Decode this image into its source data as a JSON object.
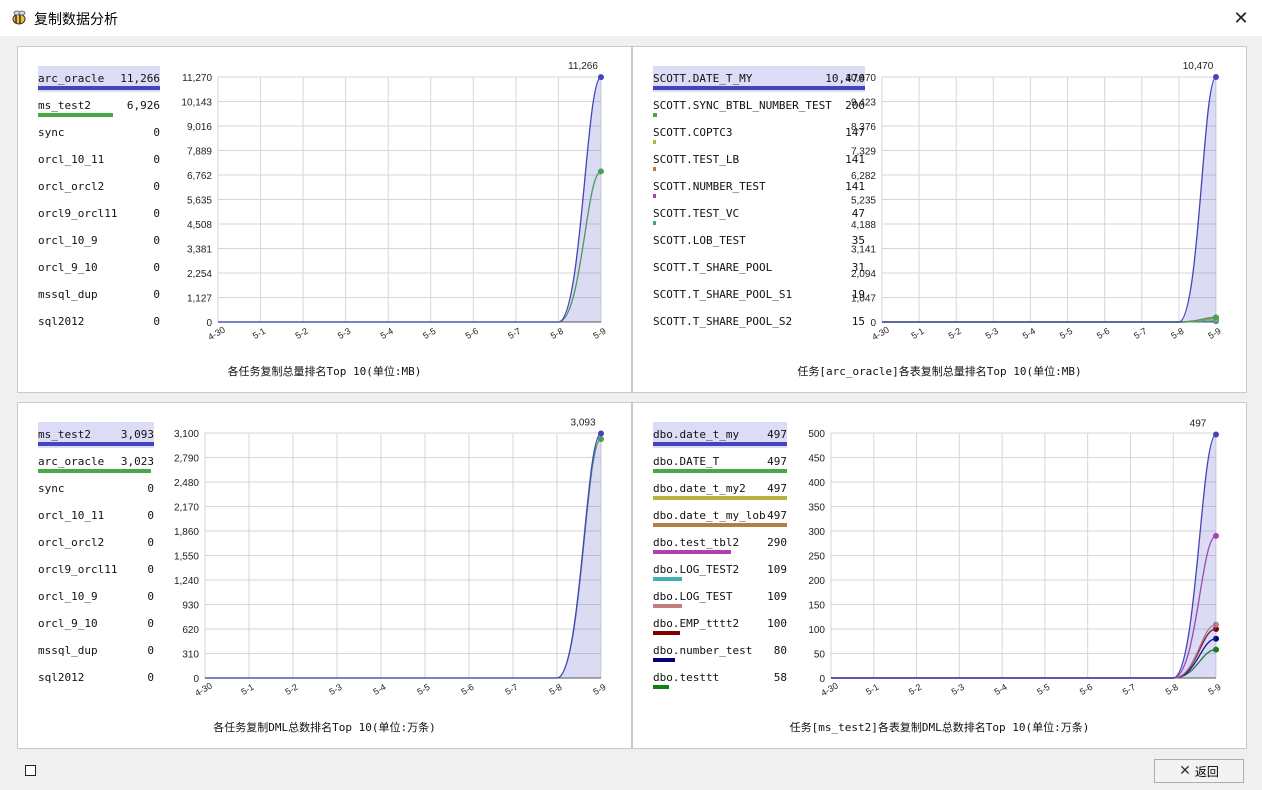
{
  "window": {
    "title": "复制数据分析",
    "close_icon": "close-icon"
  },
  "footer": {
    "back_label": "返回"
  },
  "panels": [
    {
      "caption": "各任务复制总量排名Top 10(单位:MB)",
      "legend": [
        {
          "name": "arc_oracle",
          "value": "11,266",
          "color": "#4444bb",
          "selected": true
        },
        {
          "name": "ms_test2",
          "value": "6,926",
          "color": "#44aa44"
        },
        {
          "name": "sync",
          "value": "0"
        },
        {
          "name": "orcl_10_11",
          "value": "0"
        },
        {
          "name": "orcl_orcl2",
          "value": "0"
        },
        {
          "name": "orcl9_orcl11",
          "value": "0"
        },
        {
          "name": "orcl_10_9",
          "value": "0"
        },
        {
          "name": "orcl_9_10",
          "value": "0"
        },
        {
          "name": "mssql_dup",
          "value": "0"
        },
        {
          "name": "sql2012",
          "value": "0"
        }
      ],
      "chart_data": {
        "type": "area",
        "x": [
          "4-30",
          "5-1",
          "5-2",
          "5-3",
          "5-4",
          "5-5",
          "5-6",
          "5-7",
          "5-8",
          "5-9"
        ],
        "y_ticks": [
          "0",
          "1,127",
          "2,254",
          "3,381",
          "4,508",
          "5,635",
          "6,762",
          "7,889",
          "9,016",
          "10,143",
          "11,270"
        ],
        "ylim": [
          0,
          11270
        ],
        "peak_label": "11,266",
        "series": [
          {
            "name": "arc_oracle",
            "color": "#4444bb",
            "values": [
              0,
              0,
              0,
              0,
              0,
              0,
              0,
              0,
              0,
              11266
            ],
            "fill": true
          },
          {
            "name": "ms_test2",
            "color": "#44aa44",
            "values": [
              0,
              0,
              0,
              0,
              0,
              0,
              0,
              0,
              0,
              6926
            ]
          }
        ]
      }
    },
    {
      "caption": "任务[arc_oracle]各表复制总量排名Top 10(单位:MB)",
      "legend": [
        {
          "name": "SCOTT.DATE_T_MY",
          "value": "10,470",
          "color": "#4444bb",
          "selected": true
        },
        {
          "name": "SCOTT.SYNC_BTBL_NUMBER_TEST",
          "value": "200",
          "color": "#44aa44"
        },
        {
          "name": "SCOTT.COPTC3",
          "value": "147",
          "color": "#b8b040"
        },
        {
          "name": "SCOTT.TEST_LB",
          "value": "141",
          "color": "#b08040"
        },
        {
          "name": "SCOTT.NUMBER_TEST",
          "value": "141",
          "color": "#b040b0"
        },
        {
          "name": "SCOTT.TEST_VC",
          "value": "47",
          "color": "#40a0a0"
        },
        {
          "name": "SCOTT.LOB_TEST",
          "value": "35"
        },
        {
          "name": "SCOTT.T_SHARE_POOL",
          "value": "31"
        },
        {
          "name": "SCOTT.T_SHARE_POOL_S1",
          "value": "19"
        },
        {
          "name": "SCOTT.T_SHARE_POOL_S2",
          "value": "15"
        }
      ],
      "chart_data": {
        "type": "area",
        "x": [
          "4-30",
          "5-1",
          "5-2",
          "5-3",
          "5-4",
          "5-5",
          "5-6",
          "5-7",
          "5-8",
          "5-9"
        ],
        "y_ticks": [
          "0",
          "1,047",
          "2,094",
          "3,141",
          "4,188",
          "5,235",
          "6,282",
          "7,329",
          "8,376",
          "9,423",
          "10,470"
        ],
        "ylim": [
          0,
          10470
        ],
        "peak_label": "10,470",
        "series": [
          {
            "name": "SCOTT.DATE_T_MY",
            "color": "#4444bb",
            "values": [
              0,
              0,
              0,
              0,
              0,
              0,
              0,
              0,
              0,
              10470
            ],
            "fill": true
          },
          {
            "name": "SCOTT.SYNC_BTBL_NUMBER_TEST",
            "color": "#44aa44",
            "values": [
              0,
              0,
              0,
              0,
              0,
              0,
              0,
              0,
              0,
              200
            ]
          },
          {
            "name": "SCOTT.COPTC3",
            "color": "#b8b040",
            "values": [
              0,
              0,
              0,
              0,
              0,
              0,
              0,
              0,
              0,
              147
            ]
          },
          {
            "name": "SCOTT.TEST_LB",
            "color": "#b08040",
            "values": [
              0,
              0,
              0,
              0,
              0,
              0,
              0,
              0,
              0,
              141
            ]
          },
          {
            "name": "SCOTT.NUMBER_TEST",
            "color": "#b040b0",
            "values": [
              0,
              0,
              0,
              0,
              0,
              0,
              0,
              0,
              0,
              141
            ]
          },
          {
            "name": "SCOTT.TEST_VC",
            "color": "#40a0a0",
            "values": [
              0,
              0,
              0,
              0,
              0,
              0,
              0,
              0,
              0,
              47
            ]
          },
          {
            "name": "SCOTT.LOB_TEST",
            "color": "#108010",
            "values": [
              0,
              0,
              0,
              0,
              0,
              0,
              0,
              0,
              0,
              35
            ]
          }
        ]
      }
    },
    {
      "caption": "各任务复制DML总数排名Top 10(单位:万条)",
      "legend": [
        {
          "name": "ms_test2",
          "value": "3,093",
          "color": "#4444bb",
          "selected": true
        },
        {
          "name": "arc_oracle",
          "value": "3,023",
          "color": "#44aa44"
        },
        {
          "name": "sync",
          "value": "0"
        },
        {
          "name": "orcl_10_11",
          "value": "0"
        },
        {
          "name": "orcl_orcl2",
          "value": "0"
        },
        {
          "name": "orcl9_orcl11",
          "value": "0"
        },
        {
          "name": "orcl_10_9",
          "value": "0"
        },
        {
          "name": "orcl_9_10",
          "value": "0"
        },
        {
          "name": "mssql_dup",
          "value": "0"
        },
        {
          "name": "sql2012",
          "value": "0"
        }
      ],
      "chart_data": {
        "type": "area",
        "x": [
          "4-30",
          "5-1",
          "5-2",
          "5-3",
          "5-4",
          "5-5",
          "5-6",
          "5-7",
          "5-8",
          "5-9"
        ],
        "y_ticks": [
          "0",
          "310",
          "620",
          "930",
          "1,240",
          "1,550",
          "1,860",
          "2,170",
          "2,480",
          "2,790",
          "3,100"
        ],
        "ylim": [
          0,
          3100
        ],
        "peak_label": "3,093",
        "series": [
          {
            "name": "ms_test2",
            "color": "#4444bb",
            "values": [
              0,
              0,
              0,
              0,
              0,
              0,
              0,
              0,
              0,
              3093
            ],
            "fill": true
          },
          {
            "name": "arc_oracle",
            "color": "#44aa44",
            "values": [
              0,
              0,
              0,
              0,
              0,
              0,
              0,
              0,
              0,
              3023
            ]
          }
        ]
      }
    },
    {
      "caption": "任务[ms_test2]各表复制DML总数排名Top 10(单位:万条)",
      "legend": [
        {
          "name": "dbo.date_t_my",
          "value": "497",
          "color": "#4444bb",
          "selected": true
        },
        {
          "name": "dbo.DATE_T",
          "value": "497",
          "color": "#44aa44"
        },
        {
          "name": "dbo.date_t_my2",
          "value": "497",
          "color": "#b8b040"
        },
        {
          "name": "dbo.date_t_my_lob",
          "value": "497",
          "color": "#b08040"
        },
        {
          "name": "dbo.test_tbl2",
          "value": "290",
          "color": "#b040b0"
        },
        {
          "name": "dbo.LOG_TEST2",
          "value": "109",
          "color": "#40b0b0"
        },
        {
          "name": "dbo.LOG_TEST",
          "value": "109",
          "color": "#c08080"
        },
        {
          "name": "dbo.EMP_tttt2",
          "value": "100",
          "color": "#800000"
        },
        {
          "name": "dbo.number_test",
          "value": "80",
          "color": "#000080"
        },
        {
          "name": "dbo.testtt",
          "value": "58",
          "color": "#108010"
        }
      ],
      "chart_data": {
        "type": "area",
        "x": [
          "4-30",
          "5-1",
          "5-2",
          "5-3",
          "5-4",
          "5-5",
          "5-6",
          "5-7",
          "5-8",
          "5-9"
        ],
        "y_ticks": [
          "0",
          "50",
          "100",
          "150",
          "200",
          "250",
          "300",
          "350",
          "400",
          "450",
          "500"
        ],
        "ylim": [
          0,
          500
        ],
        "peak_label": "497",
        "series": [
          {
            "name": "dbo.date_t_my",
            "color": "#4444bb",
            "values": [
              0,
              0,
              0,
              0,
              0,
              0,
              0,
              0,
              0,
              497
            ],
            "fill": true
          },
          {
            "name": "dbo.test_tbl2",
            "color": "#b040b0",
            "values": [
              0,
              0,
              0,
              0,
              0,
              0,
              0,
              0,
              0,
              290
            ]
          },
          {
            "name": "dbo.LOG_TEST",
            "color": "#c08080",
            "values": [
              0,
              0,
              0,
              0,
              0,
              0,
              0,
              0,
              0,
              109
            ]
          },
          {
            "name": "dbo.EMP_tttt2",
            "color": "#800000",
            "values": [
              0,
              0,
              0,
              0,
              0,
              0,
              0,
              0,
              0,
              100
            ]
          },
          {
            "name": "dbo.number_test",
            "color": "#000080",
            "values": [
              0,
              0,
              0,
              0,
              0,
              0,
              0,
              0,
              0,
              80
            ]
          },
          {
            "name": "dbo.testtt",
            "color": "#108010",
            "values": [
              0,
              0,
              0,
              0,
              0,
              0,
              0,
              0,
              0,
              58
            ]
          }
        ]
      }
    }
  ]
}
